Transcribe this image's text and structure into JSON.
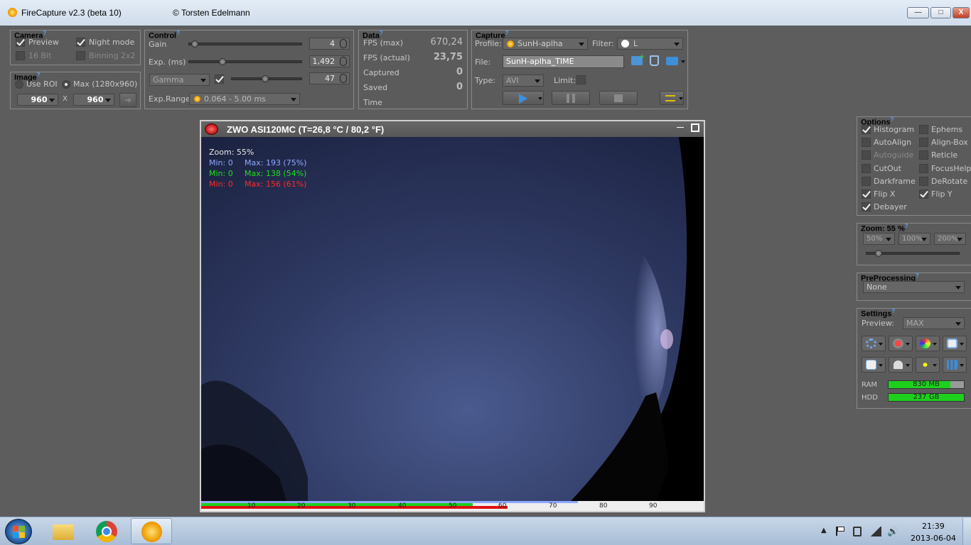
{
  "window": {
    "title": "FireCapture v2.3  (beta 10)",
    "author": "© Torsten Edelmann",
    "minimize": "—",
    "maximize": "□",
    "close": "X"
  },
  "camera": {
    "title": "Camera",
    "preview": "Preview",
    "night_mode": "Night mode",
    "bit16": "16 Bit",
    "binning": "Binning 2x2"
  },
  "image": {
    "title": "Image",
    "use_roi": "Use ROI",
    "max": "Max (1280x960)",
    "width": "960",
    "height": "960",
    "sep": "X",
    "apply": "➔"
  },
  "control": {
    "title": "Control",
    "gain_label": "Gain",
    "gain_value": "4",
    "gain_level": 0.02,
    "exp_label": "Exp. (ms)",
    "exp_value": "1,492",
    "exp_level": 0.28,
    "gamma_label": "Gamma",
    "gamma_value": "47",
    "gamma_level": 0.47,
    "exprange_label": "Exp.Range",
    "exprange_value": "0.064 - 5.00 ms"
  },
  "data": {
    "title": "Data",
    "rows": [
      {
        "label": "FPS (max)",
        "value": "670,24",
        "bold": false
      },
      {
        "label": "FPS (actual)",
        "value": "23,75",
        "bold": true
      },
      {
        "label": "Captured",
        "value": "0",
        "bold": true
      },
      {
        "label": "Saved",
        "value": "0",
        "bold": true
      },
      {
        "label": "Time",
        "value": "",
        "bold": false
      }
    ]
  },
  "capture": {
    "title": "Capture",
    "profile_label": "Profile:",
    "profile_value": "SunH-aplha",
    "filter_label": "Filter:",
    "filter_value": "L",
    "file_label": "File:",
    "file_value": "SunH-aplha_TIME",
    "type_label": "Type:",
    "type_value": "AVI",
    "limit_label": "Limit:"
  },
  "viewer": {
    "title": "ZWO ASI120MC  (T=26,8 °C / 80,2 °F)",
    "minimize": "—",
    "zoom_text": "Zoom: 55%",
    "stats": [
      {
        "min": "Min: 0",
        "max": "Max: 193 (75%)",
        "color": "#8fa8ff"
      },
      {
        "min": "Min: 0",
        "max": "Max: 138 (54%)",
        "color": "#22dd22"
      },
      {
        "min": "Min: 0",
        "max": "Max: 156 (61%)",
        "color": "#ff2a2a"
      }
    ],
    "scale_ticks": [
      "10",
      "20",
      "30",
      "40",
      "50",
      "60",
      "70",
      "80",
      "90"
    ],
    "histogram": {
      "blue": 0.75,
      "green": 0.54,
      "red": 0.61
    }
  },
  "options": {
    "title": "Options",
    "items": [
      {
        "label": "Histogram",
        "checked": true,
        "enabled": true
      },
      {
        "label": "Ephems",
        "checked": false,
        "enabled": true
      },
      {
        "label": "AutoAlign",
        "checked": false,
        "enabled": true
      },
      {
        "label": "Align-Box",
        "checked": false,
        "enabled": true
      },
      {
        "label": "Autoguide",
        "checked": false,
        "enabled": false
      },
      {
        "label": "Reticle",
        "checked": false,
        "enabled": true
      },
      {
        "label": "CutOut",
        "checked": false,
        "enabled": true
      },
      {
        "label": "FocusHelp",
        "checked": false,
        "enabled": true
      },
      {
        "label": "Darkframe",
        "checked": false,
        "enabled": true
      },
      {
        "label": "DeRotate",
        "checked": false,
        "enabled": true
      },
      {
        "label": "Flip X",
        "checked": true,
        "enabled": true
      },
      {
        "label": "Flip Y",
        "checked": true,
        "enabled": true
      },
      {
        "label": "Debayer",
        "checked": true,
        "enabled": true
      }
    ]
  },
  "zoom": {
    "title": "Zoom: 55 %",
    "presets": [
      "50%",
      "100%",
      "200%"
    ],
    "level": 0.1
  },
  "preprocessing": {
    "title": "PreProcessing",
    "value": "None"
  },
  "settings": {
    "title": "Settings",
    "preview_label": "Preview:",
    "preview_value": "MAX",
    "ram_label": "RAM",
    "ram_value": "830 MB",
    "ram_fill": 0.82,
    "hdd_label": "HDD",
    "hdd_value": "237 GB",
    "hdd_fill": 1.0
  },
  "taskbar": {
    "time": "21:39",
    "date": "2013-06-04"
  },
  "colors": {
    "green": "#1ed01e",
    "blue_hist": "#8fa8ff",
    "red_hist": "#ff2a2a",
    "help": "#4fa3ff"
  }
}
